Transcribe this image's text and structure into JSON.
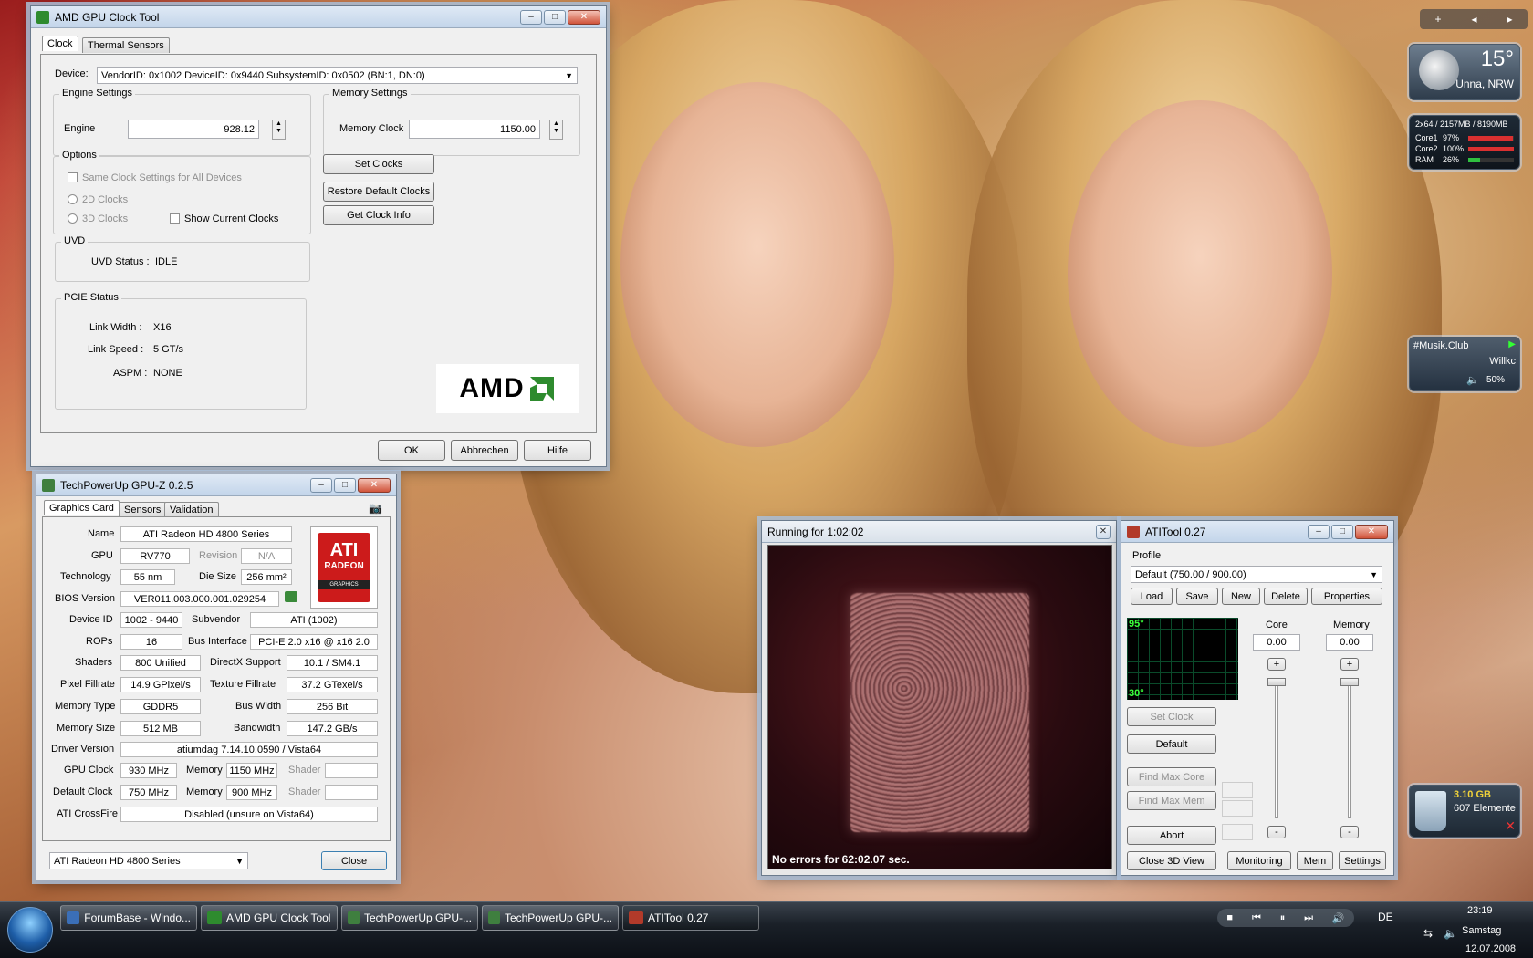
{
  "colors": {
    "accent": "#d0533a",
    "taskbar": "#111820",
    "amd_green": "#2e8b2e",
    "ati_red": "#cc1b1b"
  },
  "amd_tool": {
    "title": "AMD GPU Clock Tool",
    "tabs": [
      "Clock",
      "Thermal Sensors"
    ],
    "device_label": "Device:",
    "device_value": "VendorID: 0x1002 DeviceID: 0x9440 SubsystemID: 0x0502 (BN:1, DN:0)",
    "engine_group": "Engine Settings",
    "engine_label": "Engine",
    "engine_value": "928.12",
    "memory_group": "Memory Settings",
    "memory_label": "Memory Clock",
    "memory_value": "1150.00",
    "options_group": "Options",
    "same_clock": "Same Clock Settings for All Devices",
    "clocks_2d": "2D Clocks",
    "clocks_3d": "3D Clocks",
    "show_current": "Show Current Clocks",
    "set_clocks": "Set Clocks",
    "restore_default": "Restore Default Clocks",
    "get_clock_info": "Get Clock Info",
    "uvd_group": "UVD",
    "uvd_status_label": "UVD Status :",
    "uvd_status_value": "IDLE",
    "pcie_group": "PCIE Status",
    "link_width_label": "Link Width :",
    "link_width_value": "X16",
    "link_speed_label": "Link Speed :",
    "link_speed_value": "5 GT/s",
    "aspm_label": "ASPM :",
    "aspm_value": "NONE",
    "logo": "AMD",
    "ok": "OK",
    "cancel": "Abbrechen",
    "help": "Hilfe"
  },
  "gpuz": {
    "title": "TechPowerUp GPU-Z 0.2.5",
    "tabs": [
      "Graphics Card",
      "Sensors",
      "Validation"
    ],
    "name_label": "Name",
    "name": "ATI Radeon HD 4800 Series",
    "gpu_label": "GPU",
    "gpu": "RV770",
    "revision_label": "Revision",
    "revision": "N/A",
    "tech_label": "Technology",
    "tech": "55 nm",
    "die_label": "Die Size",
    "die": "256 mm²",
    "bios_label": "BIOS Version",
    "bios": "VER011.003.000.001.029254",
    "devid_label": "Device ID",
    "devid": "1002 - 9440",
    "subvendor_label": "Subvendor",
    "subvendor": "ATI (1002)",
    "rops_label": "ROPs",
    "rops": "16",
    "bus_label": "Bus Interface",
    "bus": "PCI-E 2.0 x16 @ x16 2.0",
    "shaders_label": "Shaders",
    "shaders": "800 Unified",
    "dx_label": "DirectX Support",
    "dx": "10.1 / SM4.1",
    "pix_label": "Pixel Fillrate",
    "pix": "14.9 GPixel/s",
    "tex_label": "Texture Fillrate",
    "tex": "37.2 GTexel/s",
    "memtype_label": "Memory Type",
    "memtype": "GDDR5",
    "buswidth_label": "Bus Width",
    "buswidth": "256 Bit",
    "memsize_label": "Memory Size",
    "memsize": "512 MB",
    "bandwidth_label": "Bandwidth",
    "bandwidth": "147.2 GB/s",
    "driver_label": "Driver Version",
    "driver": "atiumdag 7.14.10.0590  / Vista64",
    "gpuclock_label": "GPU Clock",
    "gpuclock": "930 MHz",
    "mem_label": "Memory",
    "memclock": "1150 MHz",
    "shader_label": "Shader",
    "defclock_label": "Default Clock",
    "defclock": "750 MHz",
    "defmem": "900 MHz",
    "crossfire_label": "ATI CrossFire",
    "crossfire": "Disabled (unsure on Vista64)",
    "card_select": "ATI Radeon HD 4800 Series",
    "close": "Close",
    "logo_top": "ATI",
    "logo_mid": "RADEON",
    "logo_bot": "GRAPHICS"
  },
  "render": {
    "title": "Running for 1:02:02",
    "status": "No errors for 62:02.07 sec."
  },
  "atitool": {
    "title": "ATITool 0.27",
    "profile_label": "Profile",
    "profile_value": "Default (750.00 / 900.00)",
    "load": "Load",
    "save": "Save",
    "new": "New",
    "delete": "Delete",
    "properties": "Properties",
    "temp_hi": "95°",
    "temp_lo": "30°",
    "core_label": "Core",
    "core_value": "0.00",
    "memory_label": "Memory",
    "memory_value": "0.00",
    "set_clock": "Set Clock",
    "default": "Default",
    "find_core": "Find Max Core",
    "find_mem": "Find Max Mem",
    "abort": "Abort",
    "close3d": "Close 3D View",
    "monitoring": "Monitoring",
    "mem": "Mem",
    "settings": "Settings",
    "plus": "+",
    "minus": "-"
  },
  "gadgets": {
    "weather_temp": "15°",
    "weather_loc": "Unna, NRW",
    "cpu_header": "2x64 / 2157MB / 8190MB",
    "cpu_rows": [
      {
        "label": "Core1",
        "value": "97%",
        "level": 0.97
      },
      {
        "label": "Core2",
        "value": "100%",
        "level": 1.0
      },
      {
        "label": "RAM",
        "value": "26%",
        "level": 0.26
      }
    ],
    "radio_title": "#Musik.Club",
    "radio_text": "Willkc",
    "radio_volume": "50%",
    "bin_size": "3.10 GB",
    "bin_items": "607 Elemente"
  },
  "taskbar": {
    "items": [
      "ForumBase - Windo...",
      "AMD GPU Clock Tool",
      "TechPowerUp GPU-...",
      "TechPowerUp GPU-...",
      "ATITool 0.27"
    ],
    "lang": "DE",
    "time": "23:19",
    "day": "Samstag",
    "date": "12.07.2008"
  }
}
